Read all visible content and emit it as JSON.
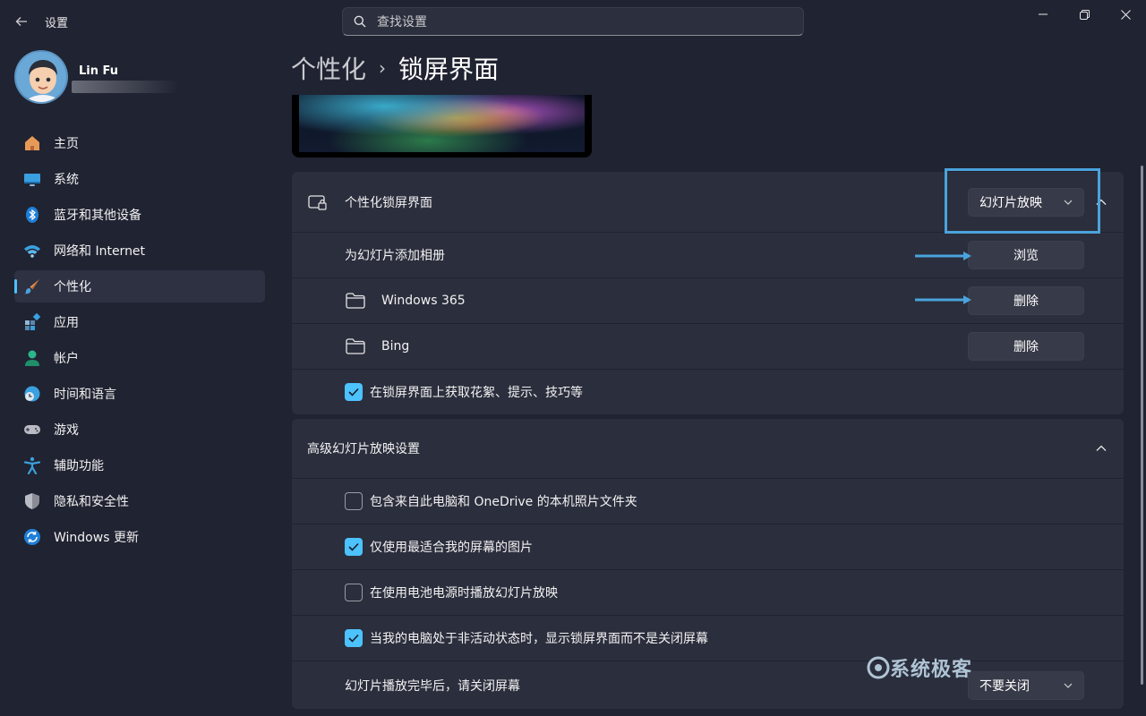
{
  "app": {
    "title": "设置"
  },
  "search": {
    "placeholder": "查找设置"
  },
  "user": {
    "name": "Lin Fu"
  },
  "sidebar": {
    "items": [
      {
        "label": "主页",
        "icon": "home-icon"
      },
      {
        "label": "系统",
        "icon": "display-icon"
      },
      {
        "label": "蓝牙和其他设备",
        "icon": "bluetooth-icon"
      },
      {
        "label": "网络和 Internet",
        "icon": "wifi-icon"
      },
      {
        "label": "个性化",
        "icon": "brush-icon",
        "active": true
      },
      {
        "label": "应用",
        "icon": "apps-icon"
      },
      {
        "label": "帐户",
        "icon": "person-icon"
      },
      {
        "label": "时间和语言",
        "icon": "clock-globe-icon"
      },
      {
        "label": "游戏",
        "icon": "gamepad-icon"
      },
      {
        "label": "辅助功能",
        "icon": "accessibility-icon"
      },
      {
        "label": "隐私和安全性",
        "icon": "shield-icon"
      },
      {
        "label": "Windows 更新",
        "icon": "update-icon"
      }
    ]
  },
  "breadcrumb": {
    "parent": "个性化",
    "separator": "›",
    "current": "锁屏界面"
  },
  "lockscreen": {
    "label": "个性化锁屏界面",
    "select_value": "幻灯片放映",
    "add_album_label": "为幻灯片添加相册",
    "browse_label": "浏览",
    "albums": [
      {
        "name": "Windows 365",
        "action": "删除"
      },
      {
        "name": "Bing",
        "action": "删除"
      }
    ],
    "tips_label": "在锁屏界面上获取花絮、提示、技巧等",
    "tips_checked": true
  },
  "advanced": {
    "title": "高级幻灯片放映设置",
    "options": [
      {
        "label": "包含来自此电脑和 OneDrive 的本机照片文件夹",
        "checked": false
      },
      {
        "label": "仅使用最适合我的屏幕的图片",
        "checked": true
      },
      {
        "label": "在使用电池电源时播放幻灯片放映",
        "checked": false
      },
      {
        "label": "当我的电脑处于非活动状态时，显示锁屏界面而不是关闭屏幕",
        "checked": true
      }
    ],
    "turn_off_label": "幻灯片播放完毕后，请关闭屏幕",
    "turn_off_value": "不要关闭"
  },
  "watermark": {
    "text": "系统极客"
  },
  "colors": {
    "accent": "#4cc2ff",
    "highlight": "#4aa3dc",
    "background": "#202331",
    "card": "#2b2e3c"
  }
}
